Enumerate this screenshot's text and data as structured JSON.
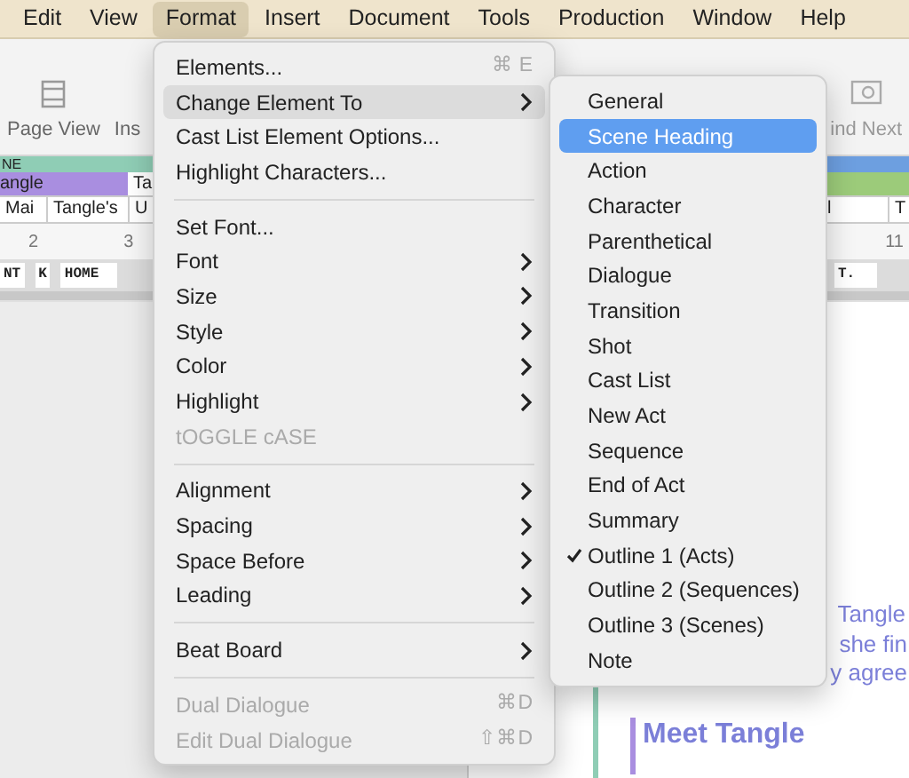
{
  "menu_bar": [
    {
      "label": "Edit",
      "selected": false
    },
    {
      "label": "View",
      "selected": false
    },
    {
      "label": "Format",
      "selected": true
    },
    {
      "label": "Insert",
      "selected": false
    },
    {
      "label": "Document",
      "selected": false
    },
    {
      "label": "Tools",
      "selected": false
    },
    {
      "label": "Production",
      "selected": false
    },
    {
      "label": "Window",
      "selected": false
    },
    {
      "label": "Help",
      "selected": false
    }
  ],
  "toolbar": {
    "left_label": "Page View",
    "cut_label": "Ins",
    "right_label": "ind Next"
  },
  "strips": {
    "row1_left": "NE",
    "row2_left": "angle",
    "row2_box": "Ta",
    "row3_cells": [
      "Mai",
      "Tangle's",
      "U"
    ],
    "row3_right": [
      "l",
      "T"
    ],
    "ruler": [
      "2",
      "3",
      "11"
    ],
    "elements_left": [
      "NT",
      "K",
      "HOME"
    ],
    "elements_right": "T."
  },
  "document": {
    "lines": [
      "Tangle",
      "she fin",
      "y agree"
    ],
    "heading": "Meet Tangle"
  },
  "format_menu": [
    {
      "kind": "item",
      "label": "Elements...",
      "shortcut": "⌘ E",
      "submenu": false,
      "disabled": false,
      "selected": false
    },
    {
      "kind": "item",
      "label": "Change Element To",
      "submenu": true,
      "disabled": false,
      "selected": true
    },
    {
      "kind": "item",
      "label": "Cast List Element Options...",
      "submenu": false,
      "disabled": false,
      "selected": false
    },
    {
      "kind": "item",
      "label": "Highlight Characters...",
      "submenu": false,
      "disabled": false,
      "selected": false
    },
    {
      "kind": "separator"
    },
    {
      "kind": "item",
      "label": "Set Font...",
      "submenu": false,
      "disabled": false,
      "selected": false
    },
    {
      "kind": "item",
      "label": "Font",
      "submenu": true,
      "disabled": false,
      "selected": false
    },
    {
      "kind": "item",
      "label": "Size",
      "submenu": true,
      "disabled": false,
      "selected": false
    },
    {
      "kind": "item",
      "label": "Style",
      "submenu": true,
      "disabled": false,
      "selected": false
    },
    {
      "kind": "item",
      "label": "Color",
      "submenu": true,
      "disabled": false,
      "selected": false
    },
    {
      "kind": "item",
      "label": "Highlight",
      "submenu": true,
      "disabled": false,
      "selected": false
    },
    {
      "kind": "item",
      "label": "tOGGLE cASE",
      "submenu": false,
      "disabled": true,
      "selected": false
    },
    {
      "kind": "separator"
    },
    {
      "kind": "item",
      "label": "Alignment",
      "submenu": true,
      "disabled": false,
      "selected": false
    },
    {
      "kind": "item",
      "label": "Spacing",
      "submenu": true,
      "disabled": false,
      "selected": false
    },
    {
      "kind": "item",
      "label": "Space Before",
      "submenu": true,
      "disabled": false,
      "selected": false
    },
    {
      "kind": "item",
      "label": "Leading",
      "submenu": true,
      "disabled": false,
      "selected": false
    },
    {
      "kind": "separator"
    },
    {
      "kind": "item",
      "label": "Beat Board",
      "submenu": true,
      "disabled": false,
      "selected": false
    },
    {
      "kind": "separator"
    },
    {
      "kind": "item",
      "label": "Dual Dialogue",
      "shortcut": "⌘D",
      "submenu": false,
      "disabled": true,
      "selected": false
    },
    {
      "kind": "item",
      "label": "Edit Dual Dialogue",
      "shortcut": "⇧⌘D",
      "submenu": false,
      "disabled": true,
      "selected": false
    }
  ],
  "submenu": [
    {
      "label": "General",
      "selected": false,
      "checked": false
    },
    {
      "label": "Scene Heading",
      "selected": true,
      "checked": false
    },
    {
      "label": "Action",
      "selected": false,
      "checked": false
    },
    {
      "label": "Character",
      "selected": false,
      "checked": false
    },
    {
      "label": "Parenthetical",
      "selected": false,
      "checked": false
    },
    {
      "label": "Dialogue",
      "selected": false,
      "checked": false
    },
    {
      "label": "Transition",
      "selected": false,
      "checked": false
    },
    {
      "label": "Shot",
      "selected": false,
      "checked": false
    },
    {
      "label": "Cast List",
      "selected": false,
      "checked": false
    },
    {
      "label": "New Act",
      "selected": false,
      "checked": false
    },
    {
      "label": "Sequence",
      "selected": false,
      "checked": false
    },
    {
      "label": "End of Act",
      "selected": false,
      "checked": false
    },
    {
      "label": "Summary",
      "selected": false,
      "checked": false
    },
    {
      "label": "Outline 1 (Acts)",
      "selected": false,
      "checked": true
    },
    {
      "label": "Outline 2 (Sequences)",
      "selected": false,
      "checked": false
    },
    {
      "label": "Outline 3 (Scenes)",
      "selected": false,
      "checked": false
    },
    {
      "label": "Note",
      "selected": false,
      "checked": false
    }
  ]
}
